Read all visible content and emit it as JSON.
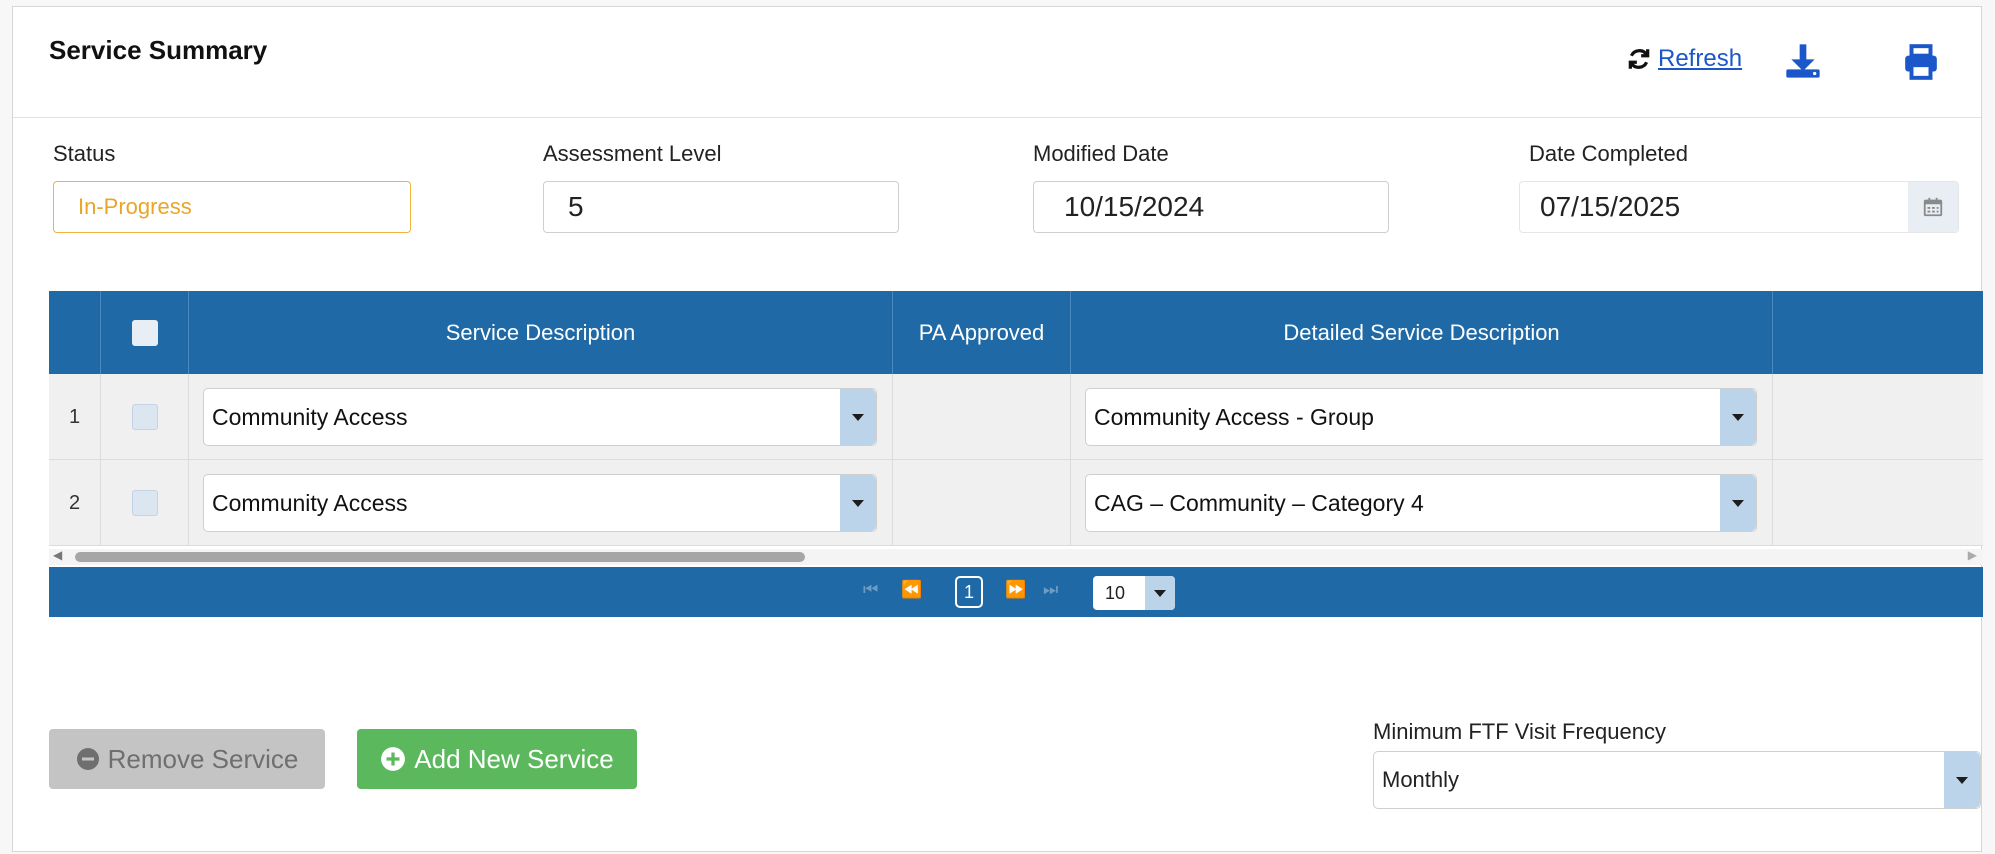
{
  "header": {
    "title": "Service Summary",
    "refresh_label": "Refresh",
    "icons": [
      "refresh-icon",
      "download-icon",
      "print-icon"
    ],
    "link_color": "#1b57c9"
  },
  "fields": {
    "status": {
      "label": "Status",
      "value": "In-Progress"
    },
    "assessment_level": {
      "label": "Assessment Level",
      "value": "5"
    },
    "modified_date": {
      "label": "Modified Date",
      "value": "10/15/2024"
    },
    "date_completed": {
      "label": "Date Completed",
      "value": "07/15/2025"
    }
  },
  "table": {
    "columns": [
      "",
      "",
      "Service Description",
      "PA Approved",
      "Detailed Service Description"
    ],
    "rows": [
      {
        "num": "1",
        "service": "Community Access",
        "pa_approved": "",
        "detailed": "Community Access - Group"
      },
      {
        "num": "2",
        "service": "Community Access",
        "pa_approved": "",
        "detailed": "CAG – Community – Category 4"
      }
    ],
    "header_color": "#1f6aa6"
  },
  "pager": {
    "current_page": "1",
    "page_size": "10"
  },
  "actions": {
    "remove_label": "Remove Service",
    "add_label": "Add New Service",
    "add_color": "#5cb85c"
  },
  "ftf": {
    "label": "Minimum FTF Visit Frequency",
    "value": "Monthly"
  },
  "status_color": "#e9a528"
}
